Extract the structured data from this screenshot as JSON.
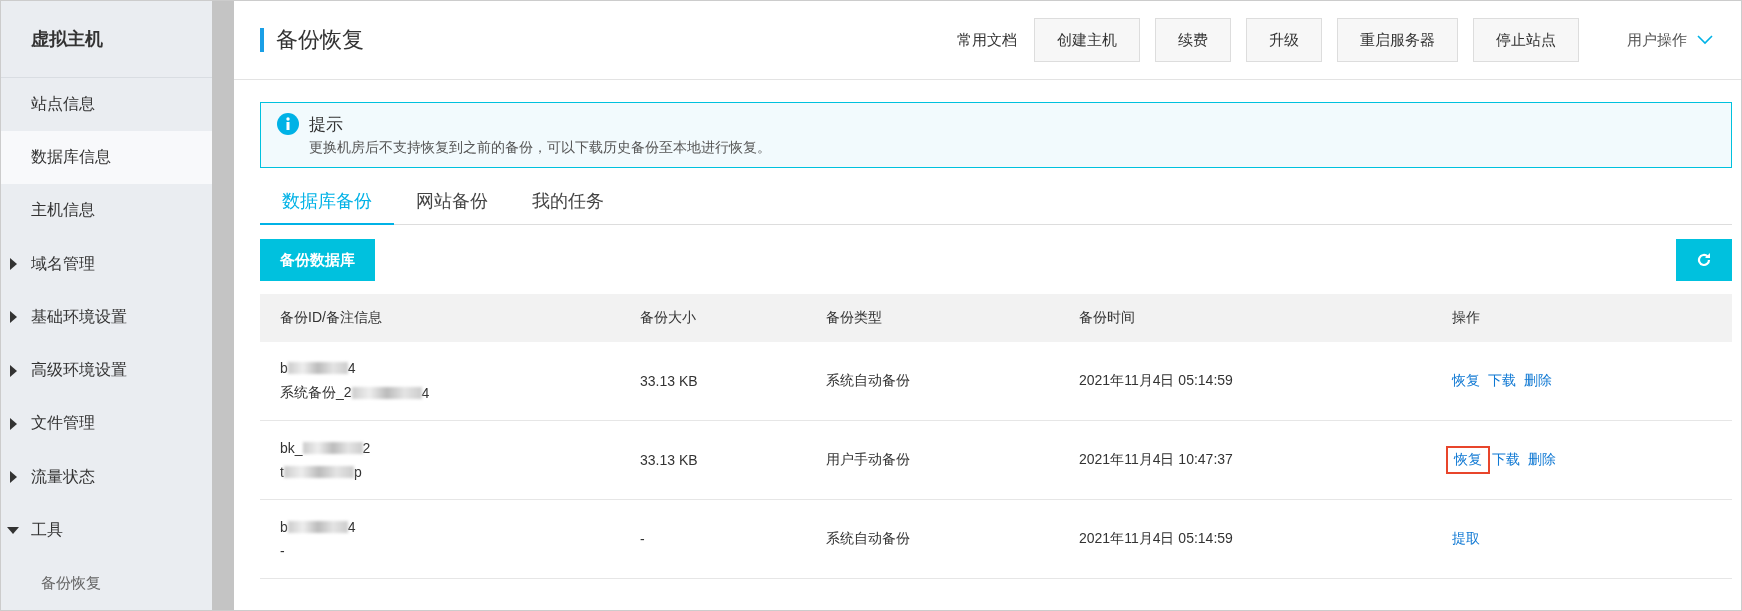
{
  "sidebar": {
    "title": "虚拟主机",
    "items": [
      {
        "label": "站点信息",
        "selected": false,
        "kind": "link"
      },
      {
        "label": "数据库信息",
        "selected": true,
        "kind": "link"
      },
      {
        "label": "主机信息",
        "selected": false,
        "kind": "link"
      },
      {
        "label": "域名管理",
        "selected": false,
        "kind": "group",
        "expanded": false
      },
      {
        "label": "基础环境设置",
        "selected": false,
        "kind": "group",
        "expanded": false
      },
      {
        "label": "高级环境设置",
        "selected": false,
        "kind": "group",
        "expanded": false
      },
      {
        "label": "文件管理",
        "selected": false,
        "kind": "group",
        "expanded": false
      },
      {
        "label": "流量状态",
        "selected": false,
        "kind": "group",
        "expanded": false
      },
      {
        "label": "工具",
        "selected": false,
        "kind": "group",
        "expanded": true,
        "children": [
          {
            "label": "备份恢复",
            "selected": false
          }
        ]
      }
    ]
  },
  "header": {
    "title": "备份恢复",
    "docs_link": "常用文档",
    "buttons": [
      "创建主机",
      "续费",
      "升级",
      "重启服务器",
      "停止站点"
    ],
    "user_menu": "用户操作"
  },
  "notice": {
    "title": "提示",
    "text": "更换机房后不支持恢复到之前的备份，可以下载历史备份至本地进行恢复。"
  },
  "tabs": [
    {
      "label": "数据库备份",
      "selected": true
    },
    {
      "label": "网站备份",
      "selected": false
    },
    {
      "label": "我的任务",
      "selected": false
    }
  ],
  "backup_button": "备份数据库",
  "table": {
    "columns": [
      "备份ID/备注信息",
      "备份大小",
      "备份类型",
      "备份时间",
      "操作"
    ],
    "rows": [
      {
        "id": "b",
        "id_tail": "4",
        "note": "系统备份_2",
        "note_tail": "4",
        "size": "33.13 KB",
        "type": "系统自动备份",
        "time": "2021年11月4日 05:14:59",
        "actions": [
          {
            "label": "恢复",
            "highlighted": false
          },
          {
            "label": "下载",
            "highlighted": false
          },
          {
            "label": "删除",
            "highlighted": false
          }
        ]
      },
      {
        "id": "bk_",
        "id_tail": "2",
        "note": "t",
        "note_tail": "p",
        "size": "33.13 KB",
        "type": "用户手动备份",
        "time": "2021年11月4日 10:47:37",
        "actions": [
          {
            "label": "恢复",
            "highlighted": true
          },
          {
            "label": "下载",
            "highlighted": false
          },
          {
            "label": "删除",
            "highlighted": false
          }
        ]
      },
      {
        "id": "b",
        "id_tail": "4",
        "note": "-",
        "size": "-",
        "type": "系统自动备份",
        "time": "2021年11月4日 05:14:59",
        "actions": [
          {
            "label": "提取",
            "highlighted": false
          }
        ]
      }
    ]
  }
}
